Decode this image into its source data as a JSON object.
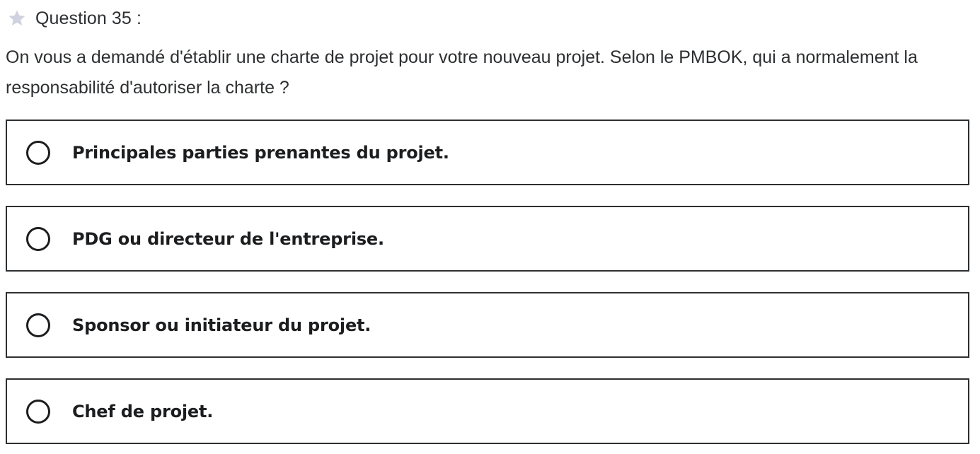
{
  "question": {
    "star_icon": "star-icon",
    "title": "Question 35 :",
    "text": "On vous a demandé d'établir une charte de projet pour votre nouveau projet. Selon le PMBOK, qui a normalement la responsabilité d'autoriser la charte ?"
  },
  "options": [
    {
      "label": "Principales parties prenantes du projet.",
      "selected": false
    },
    {
      "label": "PDG ou directeur de l'entreprise.",
      "selected": false
    },
    {
      "label": "Sponsor ou initiateur du projet.",
      "selected": false
    },
    {
      "label": "Chef de projet.",
      "selected": false
    }
  ],
  "colors": {
    "text": "#2d2f31",
    "border": "#2d2f31",
    "star": "#d1d2e0",
    "background": "#ffffff"
  }
}
